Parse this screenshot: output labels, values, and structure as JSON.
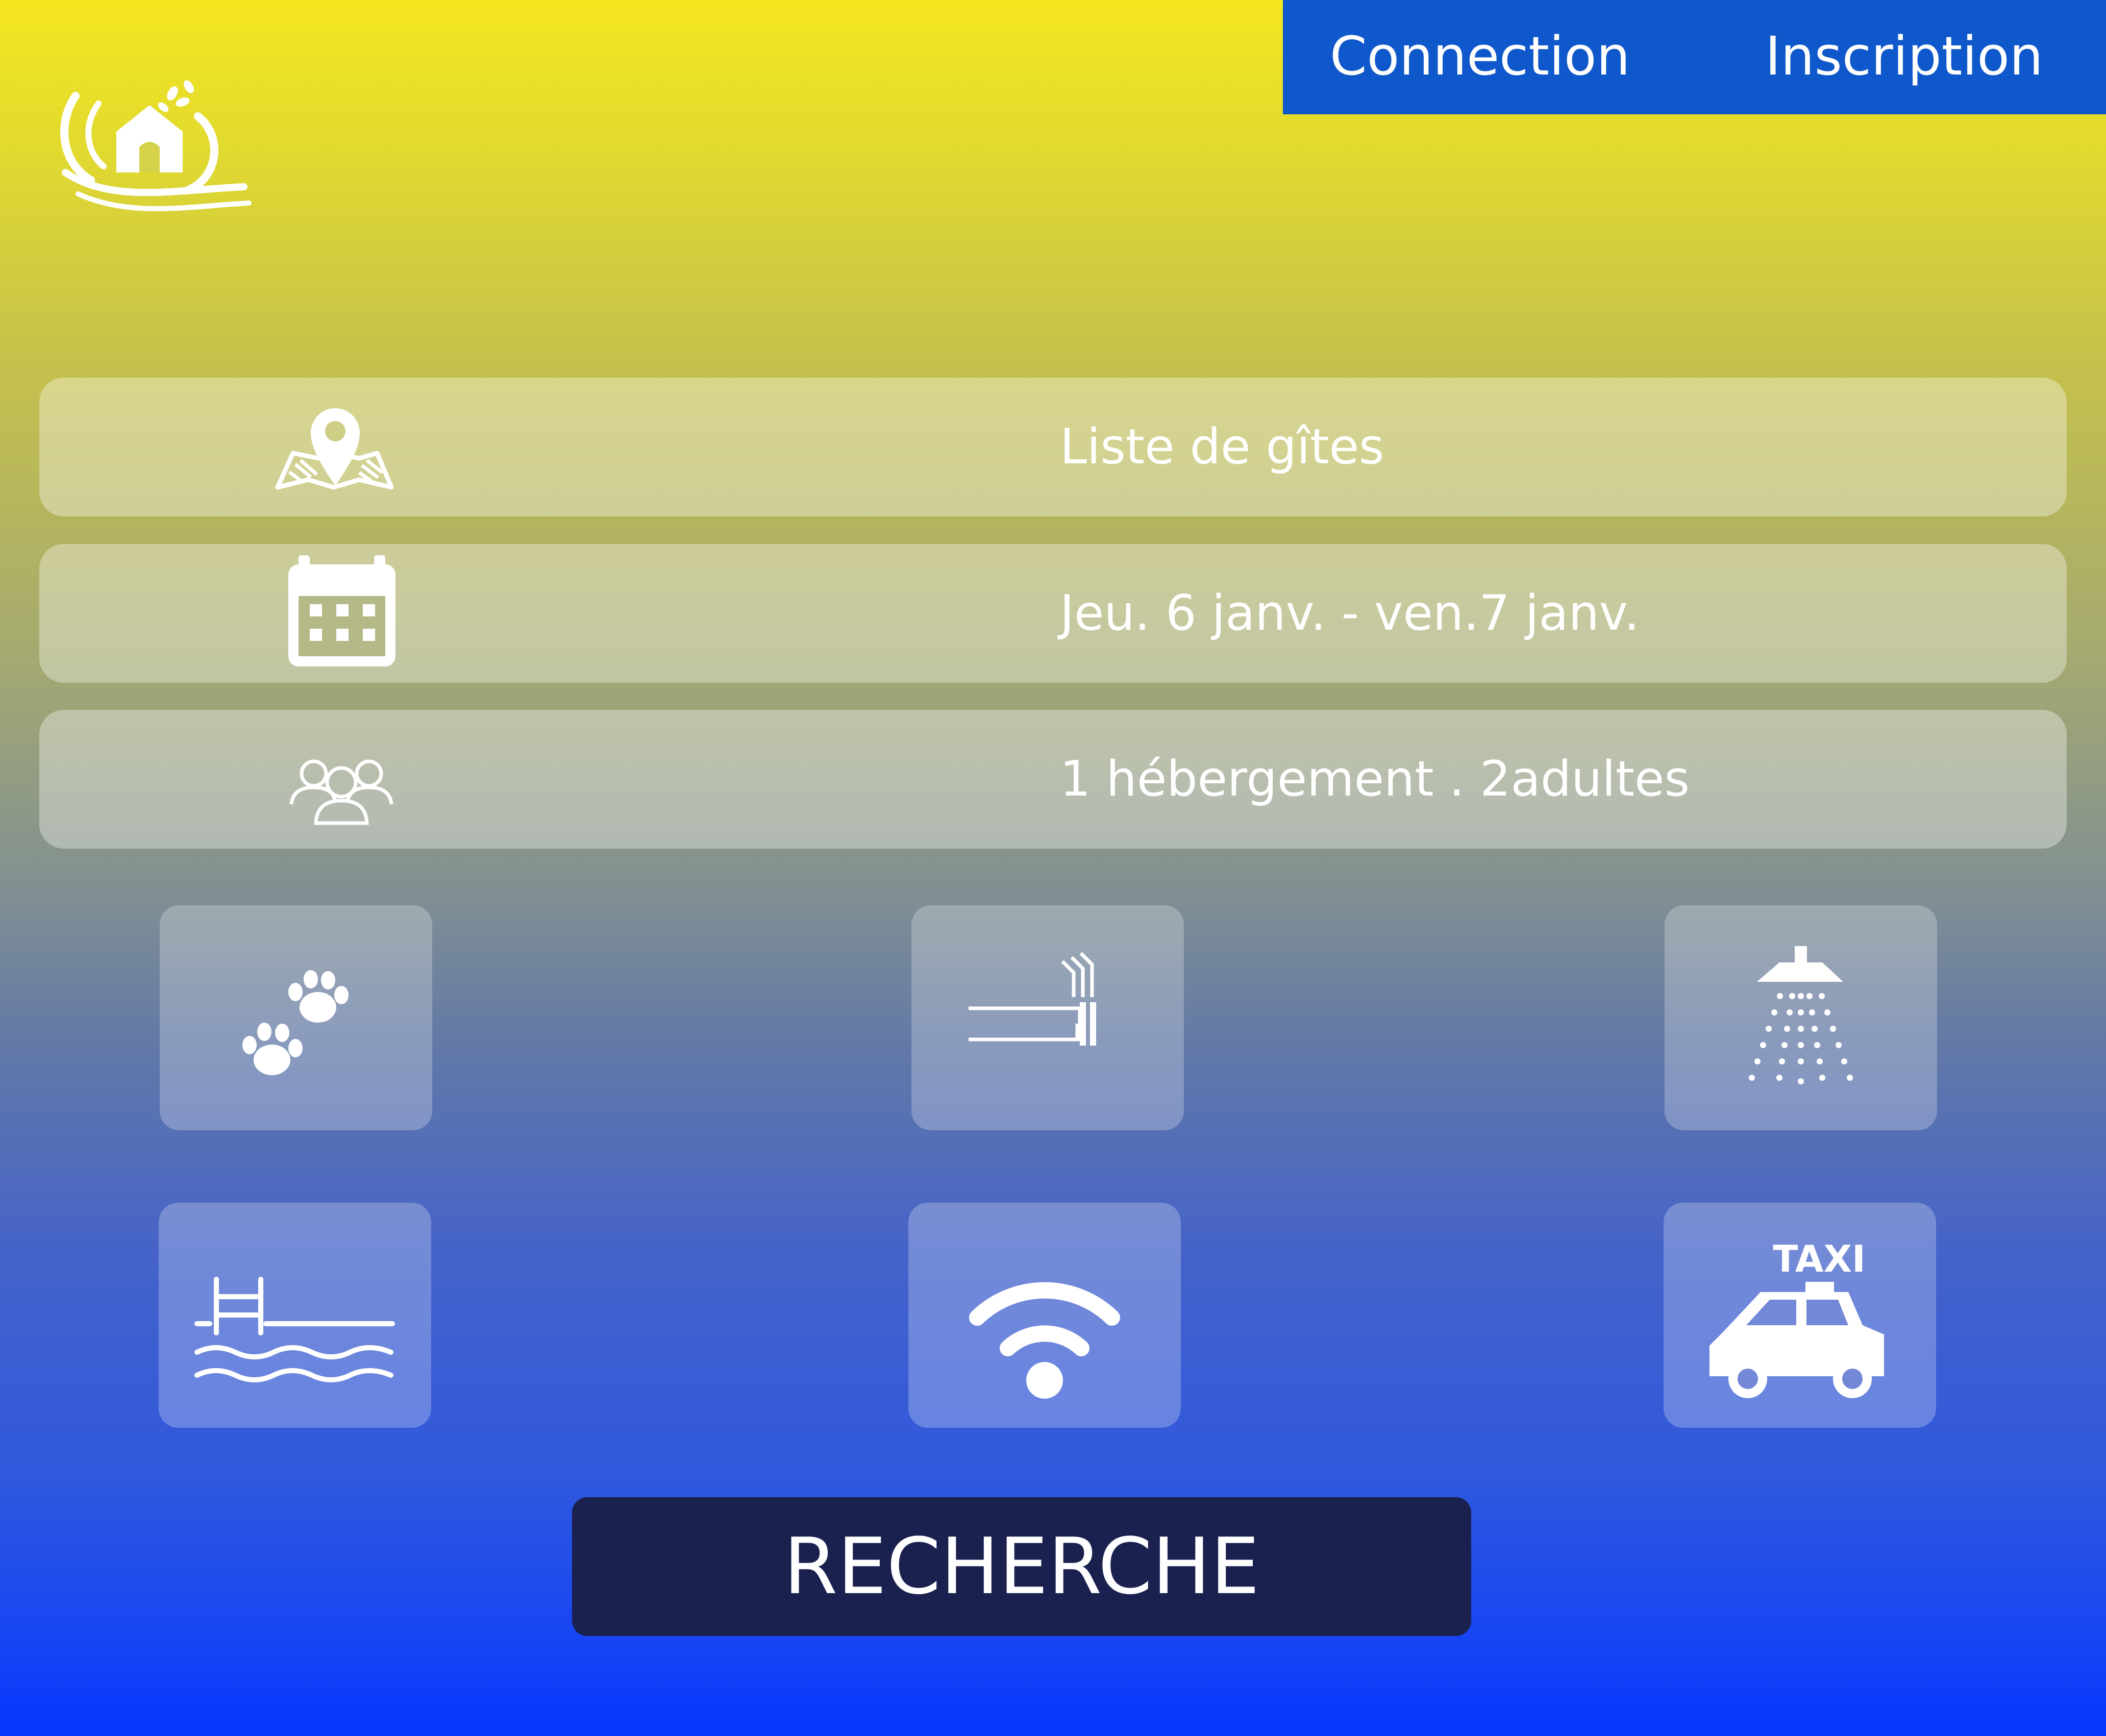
{
  "header": {
    "login_label": "Connection",
    "signup_label": "Inscription",
    "logo_icon": "cottage-logo-icon"
  },
  "search": {
    "destination": {
      "icon": "map-pin-icon",
      "value": "Liste de gîtes"
    },
    "dates": {
      "icon": "calendar-icon",
      "value": "Jeu. 6 janv. - ven.7 janv."
    },
    "guests": {
      "icon": "people-group-icon",
      "value": "1 hébergement . 2adultes"
    }
  },
  "amenities": [
    {
      "icon": "paw-prints-icon"
    },
    {
      "icon": "cigarette-icon"
    },
    {
      "icon": "shower-icon"
    },
    {
      "icon": "swimming-pool-icon"
    },
    {
      "icon": "wifi-icon"
    },
    {
      "icon": "taxi-icon",
      "badge_text": "TAXI"
    }
  ],
  "actions": {
    "search_label": "RECHERCHE"
  },
  "colors": {
    "nav_bg": "#0f58cb",
    "button_bg": "#1a214f",
    "gradient_top": "#f5e620",
    "gradient_bottom": "#0536fd"
  }
}
